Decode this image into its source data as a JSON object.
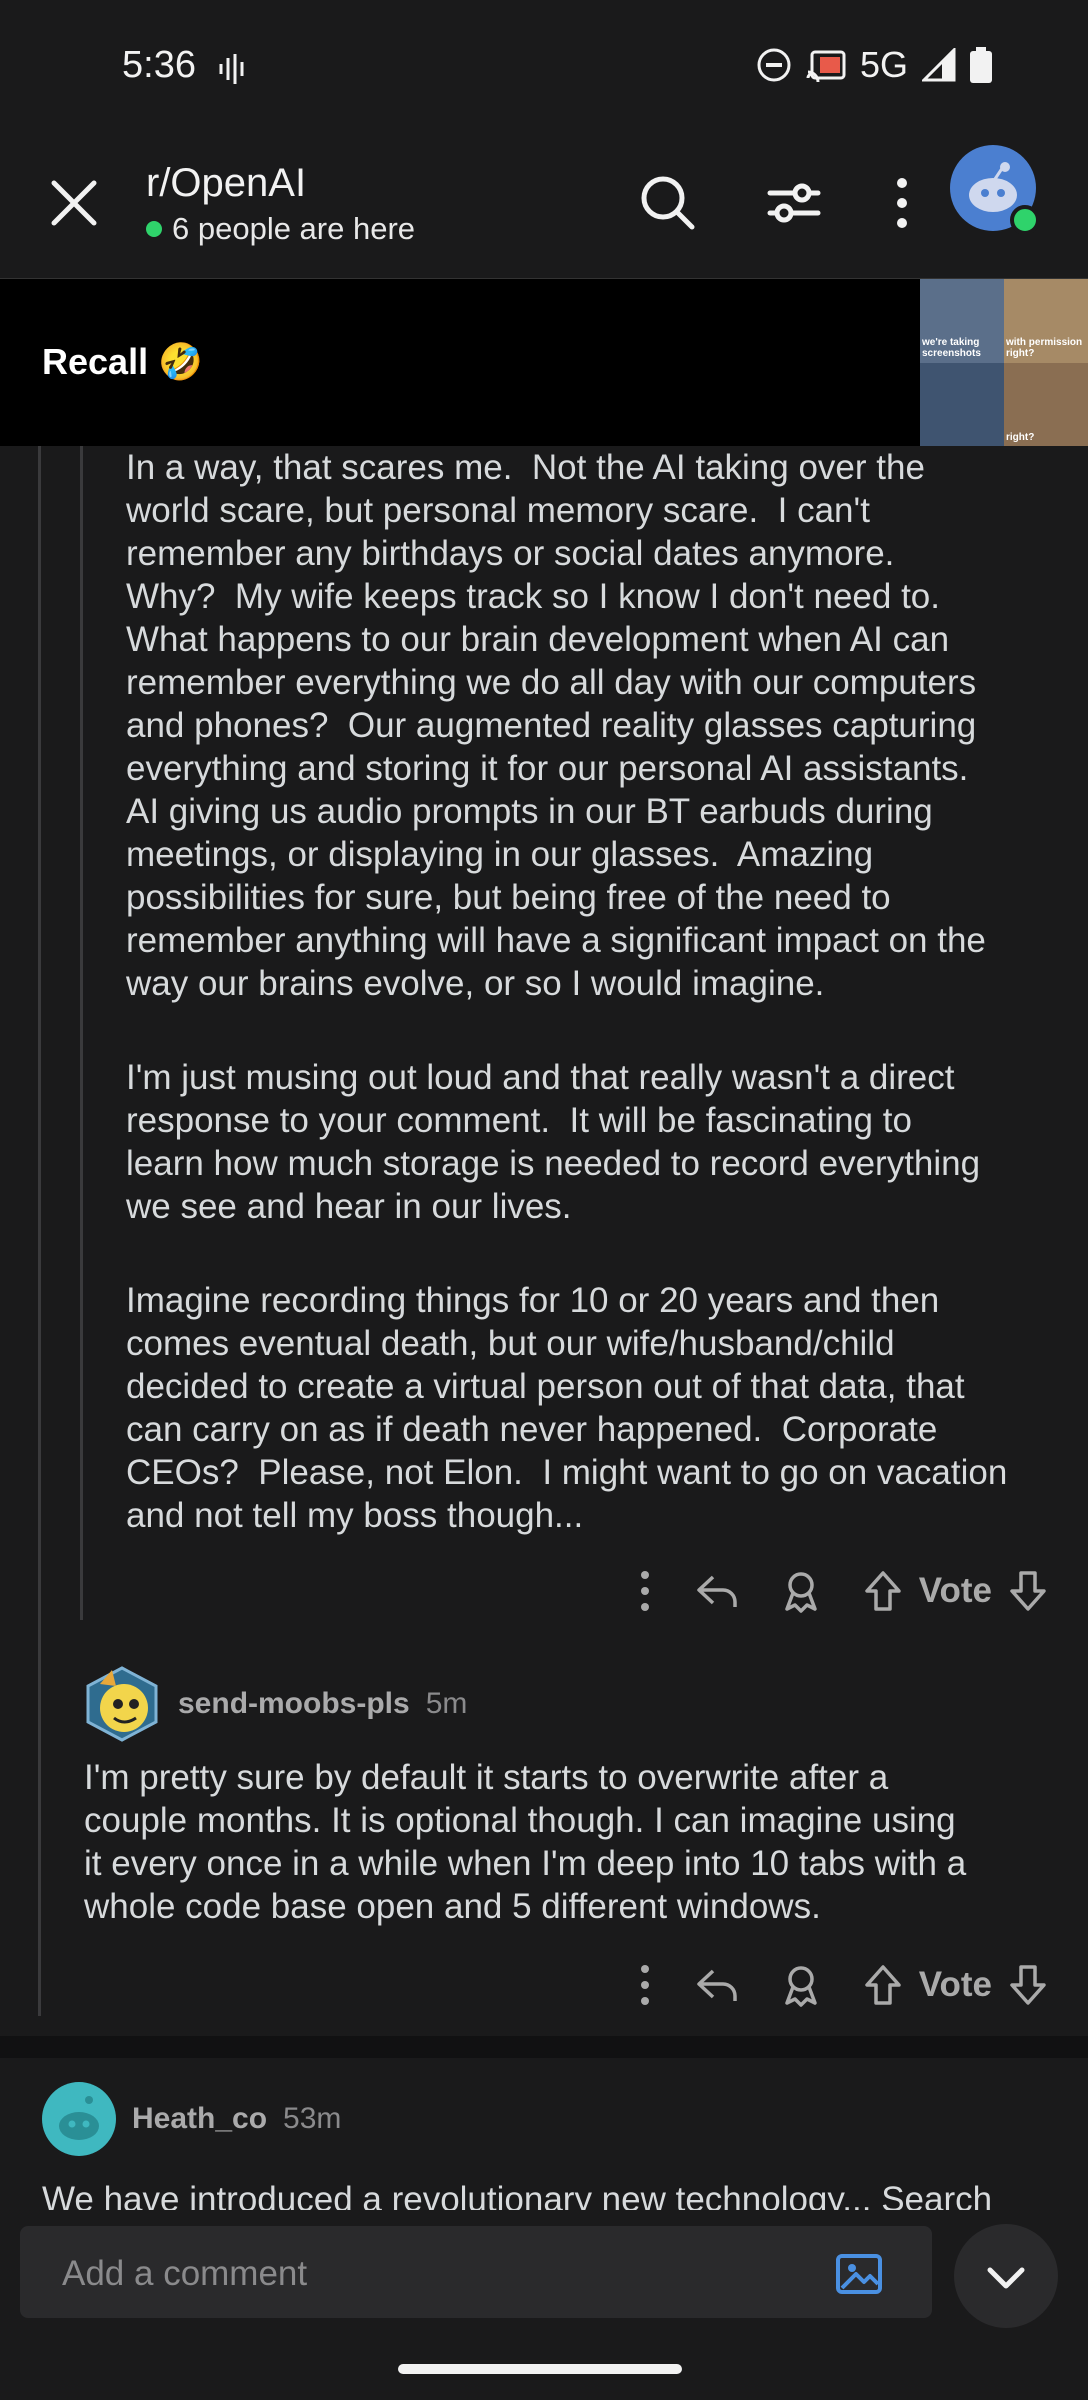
{
  "status_bar": {
    "time": "5:36",
    "network": "5G"
  },
  "header": {
    "subreddit": "r/OpenAI",
    "presence": "6 people are here"
  },
  "pinned": {
    "title": "Recall 🤣",
    "thumb_captions": [
      "we're taking screenshots",
      "with permission right?",
      "",
      "right?"
    ]
  },
  "reply1": {
    "paragraphs": [
      "In a way, that scares me.  Not the AI taking over the\nworld scare, but personal memory scare.  I can't\nremember any birthdays or social dates anymore.\nWhy?  My wife keeps track so I know I don't need to.\nWhat happens to our brain development when AI can\nremember everything we do all day with our computers\nand phones?  Our augmented reality glasses capturing\neverything and storing it for our personal AI assistants.\nAI giving us audio prompts in our BT earbuds during\nmeetings, or displaying in our glasses.  Amazing\npossibilities for sure, but being free of the need to\nremember anything will have a significant impact on the\nway our brains evolve, or so I would imagine.",
      "I'm just musing out loud and that really wasn't a direct\nresponse to your comment.  It will be fascinating to\nlearn how much storage is needed to record everything\nwe see and hear in our lives.",
      "Imagine recording things for 10 or 20 years and then\ncomes eventual death, but our wife/husband/child\ndecided to create a virtual person out of that data, that\ncan carry on as if death never happened.  Corporate\nCEOs?  Please, not Elon.  I might want to go on vacation\nand not tell my boss though..."
    ],
    "vote_label": "Vote"
  },
  "reply2": {
    "username": "send-moobs-pls",
    "time": "5m",
    "text": "I'm pretty sure by default it starts to overwrite after a\ncouple months. It is optional though. I can imagine using\nit every once in a while when I'm deep into 10 tabs with a\nwhole code base open and 5 different windows.",
    "vote_label": "Vote"
  },
  "comment3": {
    "username": "Heath_co",
    "time": "53m",
    "text": "We have introduced a revolutionary new technology... Search"
  },
  "composer": {
    "placeholder": "Add a comment"
  },
  "colors": {
    "accent": "#4a90e2",
    "online": "#2fd36b",
    "background": "#1a1a1b",
    "text": "#d7dadc"
  }
}
